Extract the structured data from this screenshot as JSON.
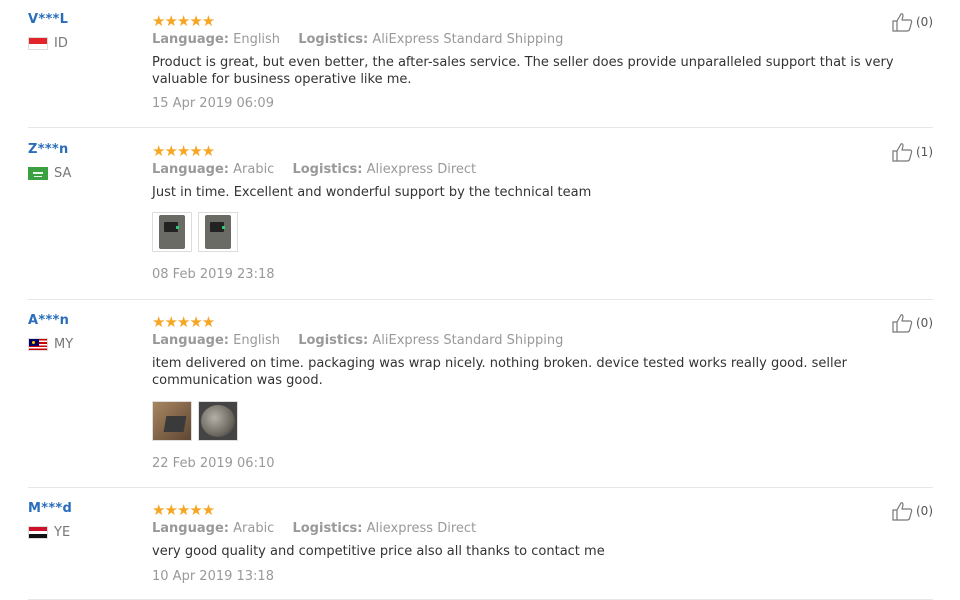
{
  "reviews": [
    {
      "user": "V***L",
      "country": "ID",
      "flag": "id",
      "stars": "★★★★★",
      "language_label": "Language:",
      "language": "English",
      "logistics_label": "Logistics:",
      "logistics": "AliExpress Standard Shipping",
      "text": "Product is great, but even better, the after-sales service. The seller does provide unparalleled support that is very valuable for business operative like me.",
      "date": "15 Apr 2019 06:09",
      "likes": "(0)"
    },
    {
      "user": "Z***n",
      "country": "SA",
      "flag": "sa",
      "stars": "★★★★★",
      "language_label": "Language:",
      "language": "Arabic",
      "logistics_label": "Logistics:",
      "logistics": "Aliexpress Direct",
      "text": "Just in time. Excellent and wonderful support by the technical team",
      "date": "08 Feb 2019 23:18",
      "likes": "(1)"
    },
    {
      "user": "A***n",
      "country": "MY",
      "flag": "my",
      "stars": "★★★★★",
      "language_label": "Language:",
      "language": "English",
      "logistics_label": "Logistics:",
      "logistics": "AliExpress Standard Shipping",
      "text": "item delivered on time. packaging was wrap nicely. nothing broken. device tested works really good. seller communication was good.",
      "date": "22 Feb 2019 06:10",
      "likes": "(0)"
    },
    {
      "user": "M***d",
      "country": "YE",
      "flag": "ye",
      "stars": "★★★★★",
      "language_label": "Language:",
      "language": "Arabic",
      "logistics_label": "Logistics:",
      "logistics": "Aliexpress Direct",
      "text": "very good quality and competitive price also all thanks to contact me",
      "date": "10 Apr 2019 13:18",
      "likes": "(0)"
    }
  ],
  "colors": {
    "star": "#f6a623",
    "username": "#2a6ebb",
    "meta": "#999999"
  },
  "icons": {
    "like": "thumbs-up-icon"
  }
}
